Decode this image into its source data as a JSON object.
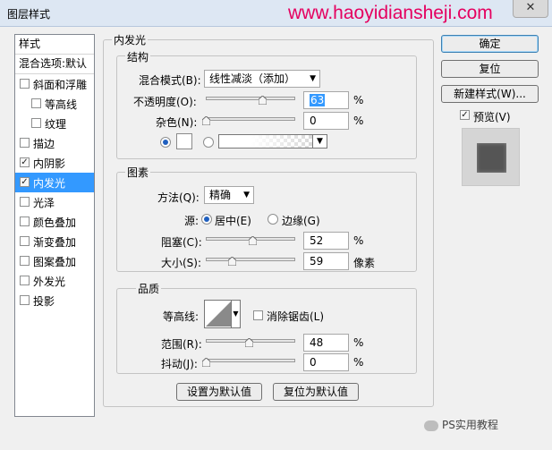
{
  "window": {
    "title": "图层样式",
    "watermark": "www.haoyidiansheji.com",
    "close_symbol": "✕"
  },
  "sidebar": {
    "header": "样式",
    "blend_options": "混合选项:默认",
    "items": [
      {
        "label": "斜面和浮雕",
        "checked": false
      },
      {
        "label": "等高线",
        "checked": false
      },
      {
        "label": "纹理",
        "checked": false
      },
      {
        "label": "描边",
        "checked": false
      },
      {
        "label": "内阴影",
        "checked": true
      },
      {
        "label": "内发光",
        "checked": true,
        "selected": true
      },
      {
        "label": "光泽",
        "checked": false
      },
      {
        "label": "颜色叠加",
        "checked": false
      },
      {
        "label": "渐变叠加",
        "checked": false
      },
      {
        "label": "图案叠加",
        "checked": false
      },
      {
        "label": "外发光",
        "checked": false
      },
      {
        "label": "投影",
        "checked": false
      }
    ]
  },
  "panel": {
    "title": "内发光",
    "structure": {
      "title": "结构",
      "blend_mode_label": "混合模式(B):",
      "blend_mode_value": "线性减淡（添加）",
      "opacity_label": "不透明度(O):",
      "opacity_value": "63",
      "opacity_unit": "%",
      "opacity_level": 0.63,
      "noise_label": "杂色(N):",
      "noise_value": "0",
      "noise_unit": "%",
      "noise_level": 0
    },
    "elements": {
      "title": "图素",
      "method_label": "方法(Q):",
      "method_value": "精确",
      "source_label": "源:",
      "source_center": "居中(E)",
      "source_edge": "边缘(G)",
      "choke_label": "阻塞(C):",
      "choke_value": "52",
      "choke_unit": "%",
      "choke_level": 0.52,
      "size_label": "大小(S):",
      "size_value": "59",
      "size_unit": "像素",
      "size_level": 0.29
    },
    "quality": {
      "title": "品质",
      "contour_label": "等高线:",
      "antialias_label": "消除锯齿(L)",
      "range_label": "范围(R):",
      "range_value": "48",
      "range_unit": "%",
      "range_level": 0.48,
      "jitter_label": "抖动(J):",
      "jitter_value": "0",
      "jitter_unit": "%",
      "jitter_level": 0
    },
    "make_default_button": "设置为默认值",
    "reset_default_button": "复位为默认值"
  },
  "buttons": {
    "ok": "确定",
    "reset": "复位",
    "new_style": "新建样式(W)...",
    "preview_label": "预览(V)"
  },
  "footer_watermark": "PS实用教程",
  "colors": {
    "selection": "#3399ff",
    "watermark": "#e5005f"
  }
}
